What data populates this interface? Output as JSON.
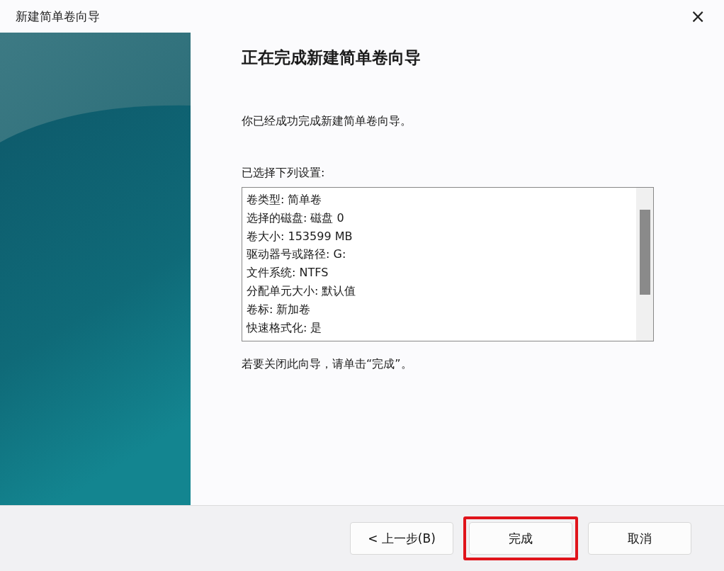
{
  "window": {
    "title": "新建简单卷向导",
    "close": "×"
  },
  "heading": "正在完成新建简单卷向导",
  "intro": "你已经成功完成新建简单卷向导。",
  "settings_label": "已选择下列设置:",
  "settings": [
    "卷类型: 简单卷",
    "选择的磁盘: 磁盘 0",
    "卷大小: 153599 MB",
    "驱动器号或路径: G:",
    "文件系统: NTFS",
    "分配单元大小: 默认值",
    "卷标: 新加卷",
    "快速格式化: 是"
  ],
  "closing_note": "若要关闭此向导，请单击“完成”。",
  "buttons": [
    {
      "label": "< 上一步(B)",
      "highlighted": false
    },
    {
      "label": "完成",
      "highlighted": true
    },
    {
      "label": "取消",
      "highlighted": false
    }
  ]
}
